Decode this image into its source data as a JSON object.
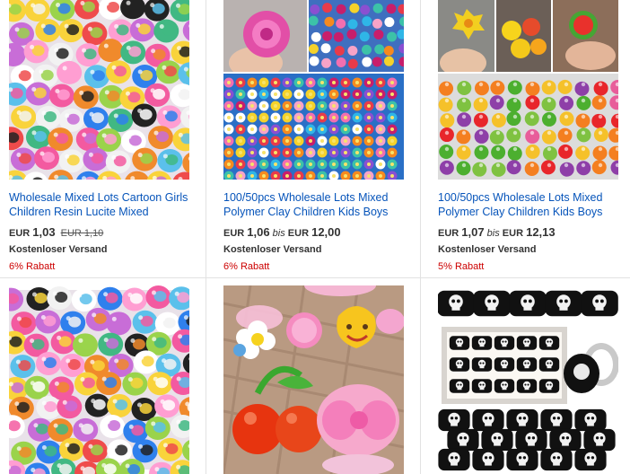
{
  "listings": [
    {
      "title": "Wholesale Mixed Lots Cartoon Girls Children Resin Lucite Mixed",
      "currency": "EUR",
      "price": "1,03",
      "bis": "",
      "price_to": "",
      "old_price": "EUR 1,10",
      "shipping": "Kostenloser Versand",
      "discount": "6% Rabatt",
      "image": "cartoon-resin-rings"
    },
    {
      "title": "100/50pcs Wholesale Lots Mixed Polymer Clay Children Kids Boys",
      "currency": "EUR",
      "price": "1,06",
      "bis": "bis",
      "price_to": "12,00",
      "old_price": "",
      "shipping": "Kostenloser Versand",
      "discount": "6% Rabatt",
      "image": "polymer-flower-rings"
    },
    {
      "title": "100/50pcs Wholesale Lots Mixed Polymer Clay Children Kids Boys",
      "currency": "EUR",
      "price": "1,07",
      "bis": "bis",
      "price_to": "12,13",
      "old_price": "",
      "shipping": "Kostenloser Versand",
      "discount": "5% Rabatt",
      "image": "polymer-fruit-rings"
    },
    {
      "image": "cartoon-resin-rings"
    },
    {
      "image": "cherry-flower-rings"
    },
    {
      "image": "skull-pirate-rings"
    }
  ]
}
